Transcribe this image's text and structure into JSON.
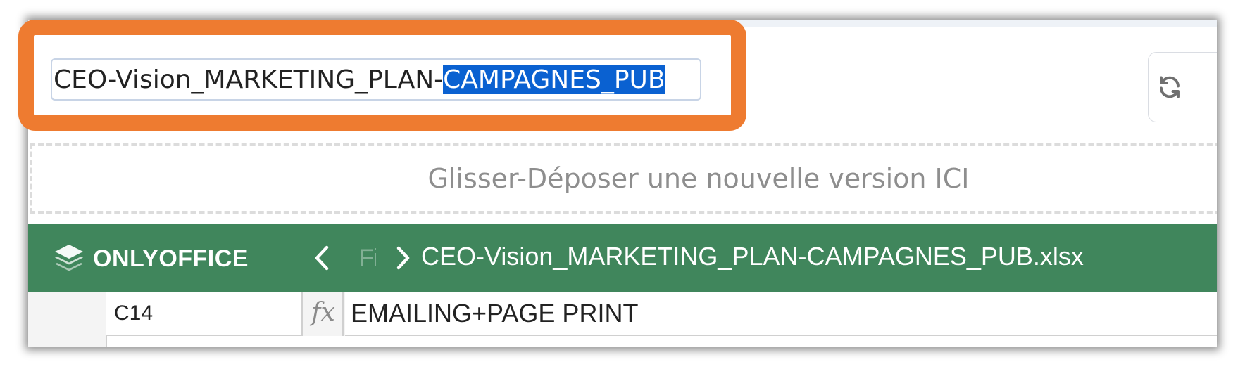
{
  "document_title": {
    "unselected_part": "CEO-Vision_MARKETING_PLAN-",
    "selected_part": "CAMPAGNES_PUB"
  },
  "refresh_button": {
    "icon": "refresh-icon"
  },
  "drop_zone": {
    "text": "Glisser-Déposer une nouvelle version ICI"
  },
  "editor_header": {
    "logo_text": "ONLYOFFICE",
    "back_icon": "chevron-left-icon",
    "faded_label": "Fi",
    "breadcrumb_icon": "chevron-right-icon",
    "file_name": "CEO-Vision_MARKETING_PLAN-CAMPAGNES_PUB.xlsx"
  },
  "formula_bar": {
    "cell_reference": "C14",
    "fx_label": "fx",
    "formula_value": "EMAILING+PAGE PRINT"
  },
  "colors": {
    "highlight": "#ee7b30",
    "onlyoffice_green": "#40865c",
    "selection_blue": "#0a61d1"
  }
}
